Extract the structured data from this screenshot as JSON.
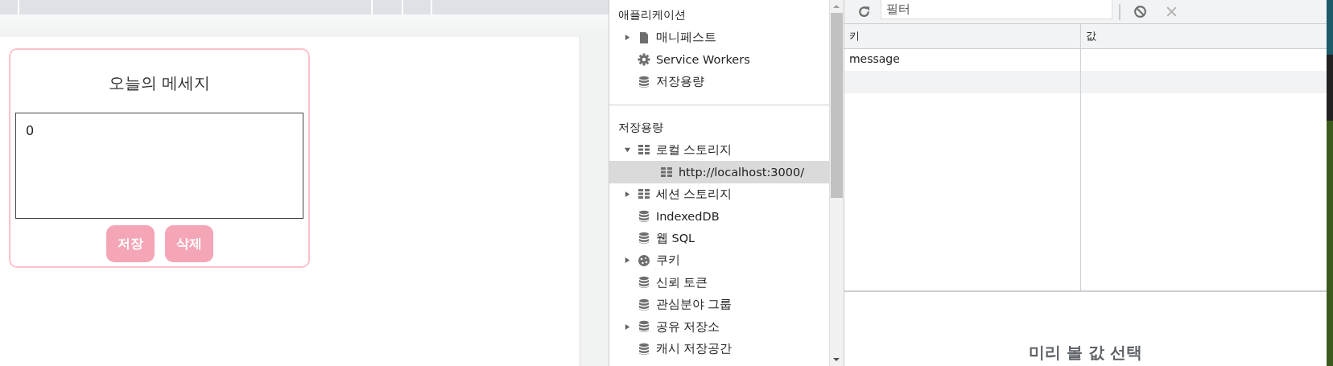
{
  "page": {
    "card": {
      "title": "오늘의 메세지",
      "message": "0",
      "buttons": [
        "저장",
        "삭제"
      ]
    }
  },
  "sidebar": {
    "sections": [
      {
        "title": "애플리케이션",
        "items": [
          {
            "label": "매니페스트",
            "kind": "file",
            "expanded": false,
            "selected": false
          },
          {
            "label": "Service Workers",
            "kind": "gear",
            "selected": false
          },
          {
            "label": "저장용량",
            "kind": "database",
            "selected": false
          }
        ]
      },
      {
        "title": "저장용량",
        "items": [
          {
            "label": "로컬 스토리지",
            "kind": "grid",
            "expanded": true,
            "selected": false,
            "children": [
              {
                "label": "http://localhost:3000/",
                "kind": "grid",
                "selected": true
              }
            ]
          },
          {
            "label": "세션 스토리지",
            "kind": "grid",
            "expanded": false,
            "selected": false
          },
          {
            "label": "IndexedDB",
            "kind": "database",
            "selected": false
          },
          {
            "label": "웹 SQL",
            "kind": "database",
            "selected": false
          },
          {
            "label": "쿠키",
            "kind": "cookie",
            "expanded": false,
            "selected": false
          },
          {
            "label": "신뢰 토큰",
            "kind": "database",
            "selected": false
          },
          {
            "label": "관심분야 그룹",
            "kind": "database",
            "selected": false
          },
          {
            "label": "공유 저장소",
            "kind": "database",
            "expanded": false,
            "selected": false
          },
          {
            "label": "캐시 저장공간",
            "kind": "database",
            "selected": false
          }
        ]
      }
    ]
  },
  "storage": {
    "filter": {
      "placeholder": "필터"
    },
    "table": {
      "columns": [
        "키",
        "값"
      ],
      "rows": [
        {
          "key": "message"
        }
      ]
    },
    "preview": "미리 볼 값 선택"
  }
}
